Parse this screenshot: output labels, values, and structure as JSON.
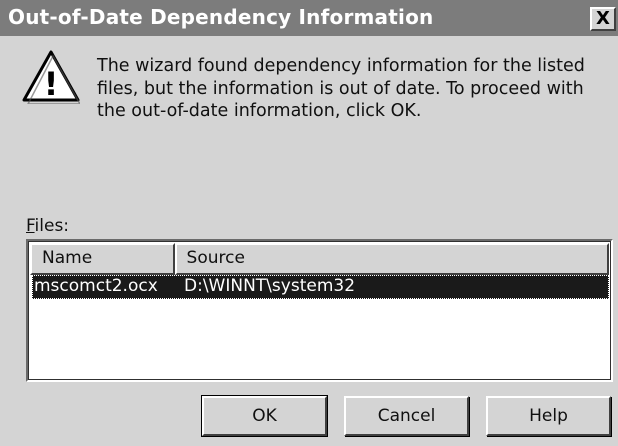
{
  "window": {
    "title": "Out-of-Date Dependency Information",
    "close_glyph": "X"
  },
  "icon": {
    "name": "warning-icon",
    "glyph": "!"
  },
  "message": "The wizard found dependency information for the listed files, but the information is out of date. To proceed with the out-of-date information, click OK.",
  "files": {
    "label_accel": "F",
    "label_rest": "iles:",
    "columns": [
      "Name",
      "Source"
    ],
    "rows": [
      {
        "name": "mscomct2.ocx",
        "source": "D:\\WINNT\\system32",
        "selected": true
      }
    ]
  },
  "buttons": {
    "ok": "OK",
    "cancel": "Cancel",
    "help": "Help"
  },
  "colors": {
    "titlebar": "#7c7c7c",
    "face": "#d4d4d4",
    "selection": "#1a1a1a"
  }
}
